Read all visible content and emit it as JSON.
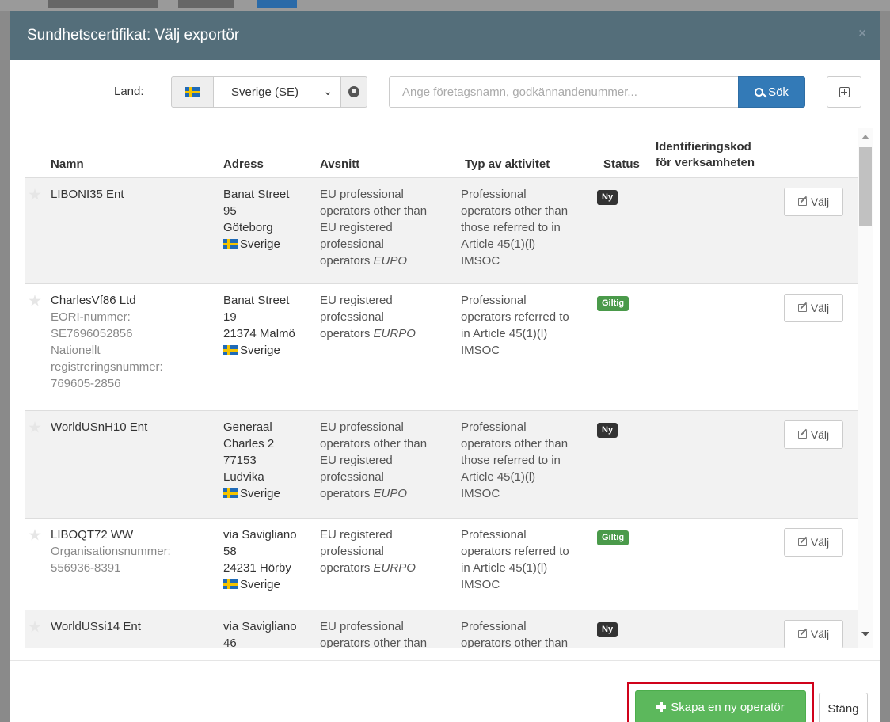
{
  "modal": {
    "title": "Sundhetscertifikat: Välj exportör",
    "close_icon": "×"
  },
  "search": {
    "land_label": "Land:",
    "country_value": "Sverige (SE)",
    "placeholder": "Ange företagsnamn, godkännandenummer...",
    "search_button": "Sök"
  },
  "table": {
    "headers": {
      "name": "Namn",
      "address": "Adress",
      "section": "Avsnitt",
      "activity": "Typ av aktivitet",
      "status": "Status",
      "idcode_line1": "Identifieringskod",
      "idcode_line2": "för verksamheten"
    },
    "rows": [
      {
        "name": "LIBONI35 Ent",
        "address": [
          "Banat Street",
          "95",
          "Göteborg"
        ],
        "country": "Sverige",
        "section_lines": [
          "EU professional",
          "operators other than",
          "EU registered",
          "professional"
        ],
        "section_last": "operators",
        "section_code": "EUPO",
        "activity": [
          "Professional",
          "operators other than",
          "those referred to in",
          "Article 45(1)(l)",
          "IMSOC"
        ],
        "status": "Ny",
        "select": "Välj"
      },
      {
        "name": "CharlesVf86 Ltd",
        "sub": [
          "EORI-nummer:",
          "SE7696052856",
          "Nationellt",
          "registreringsnummer:",
          "769605-2856"
        ],
        "address": [
          "Banat Street",
          "19",
          "21374 Malmö"
        ],
        "country": "Sverige",
        "section_lines": [
          "EU registered",
          "professional"
        ],
        "section_last": "operators",
        "section_code": "EURPO",
        "activity": [
          "Professional",
          "operators referred to",
          "in Article 45(1)(l)",
          "IMSOC"
        ],
        "status": "Giltig",
        "select": "Välj"
      },
      {
        "name": "WorldUSnH10 Ent",
        "address": [
          "Generaal",
          "Charles 2",
          "77153",
          "Ludvika"
        ],
        "country": "Sverige",
        "section_lines": [
          "EU professional",
          "operators other than",
          "EU registered",
          "professional"
        ],
        "section_last": "operators",
        "section_code": "EUPO",
        "activity": [
          "Professional",
          "operators other than",
          "those referred to in",
          "Article 45(1)(l)",
          "IMSOC"
        ],
        "status": "Ny",
        "select": "Välj"
      },
      {
        "name": "LIBOQT72 WW",
        "sub": [
          "Organisationsnummer:",
          "556936-8391"
        ],
        "address": [
          "via Savigliano",
          "58",
          "24231 Hörby"
        ],
        "country": "Sverige",
        "section_lines": [
          "EU registered",
          "professional"
        ],
        "section_last": "operators",
        "section_code": "EURPO",
        "activity": [
          "Professional",
          "operators referred to",
          "in Article 45(1)(l)",
          "IMSOC"
        ],
        "status": "Giltig",
        "select": "Välj"
      },
      {
        "name": "WorldUSsi14 Ent",
        "address": [
          "via Savigliano",
          "46"
        ],
        "section_lines": [
          "EU professional",
          "operators other than"
        ],
        "activity": [
          "Professional",
          "operators other than"
        ],
        "status": "Ny",
        "select": "Välj"
      }
    ]
  },
  "footer": {
    "create_button": "Skapa en ny operatör",
    "close_button": "Stäng"
  },
  "colors": {
    "header_bg": "#546e7a",
    "primary": "#337ab7",
    "success": "#5cb85c",
    "highlight": "#d0021b"
  }
}
